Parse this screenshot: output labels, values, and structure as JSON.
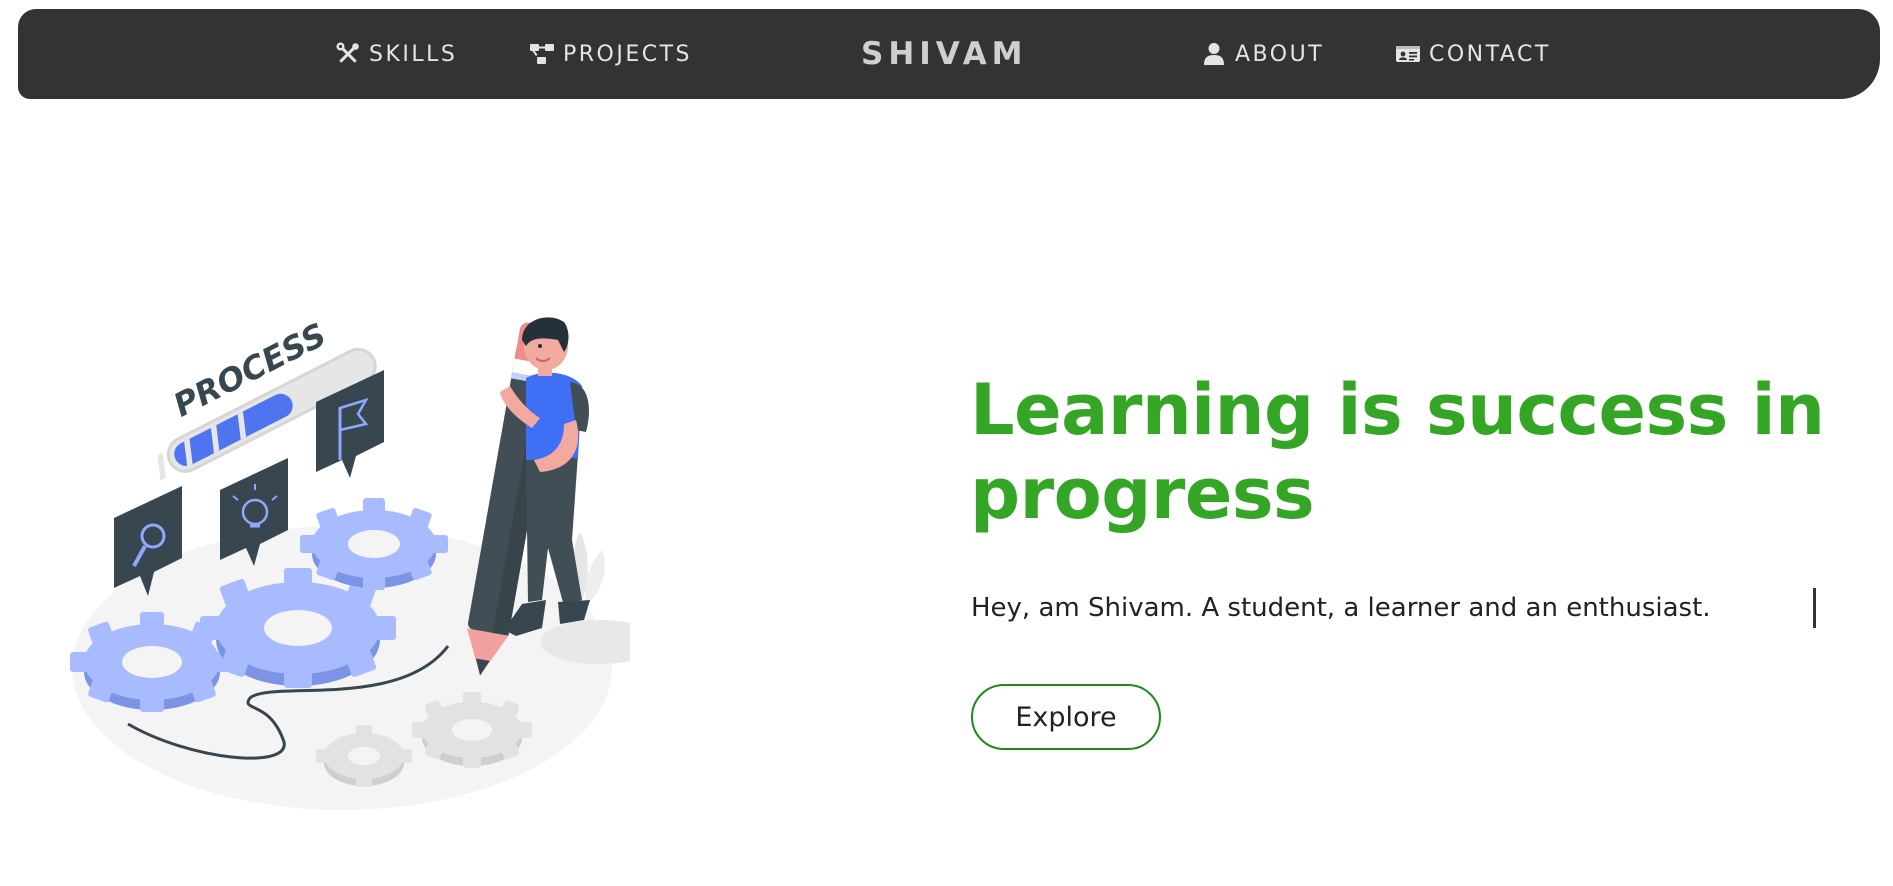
{
  "navbar": {
    "brand": "SHIVAM",
    "items": [
      {
        "label": "SKILLS",
        "icon": "tools-icon"
      },
      {
        "label": "PROJECTS",
        "icon": "project-diagram-icon"
      },
      {
        "label": "ABOUT",
        "icon": "user-icon"
      },
      {
        "label": "CONTACT",
        "icon": "id-card-icon"
      }
    ]
  },
  "hero": {
    "title": "Learning is success in progress",
    "subtitle": "Hey, am Shivam. A student, a learner and an enthusiast.",
    "button_label": "Explore",
    "illustration_text": "PROCESS"
  },
  "colors": {
    "navbar_bg": "#333333",
    "title_green": "#34a524",
    "button_border": "#1e8a1e",
    "illustration_blue": "#5a7cf0"
  }
}
